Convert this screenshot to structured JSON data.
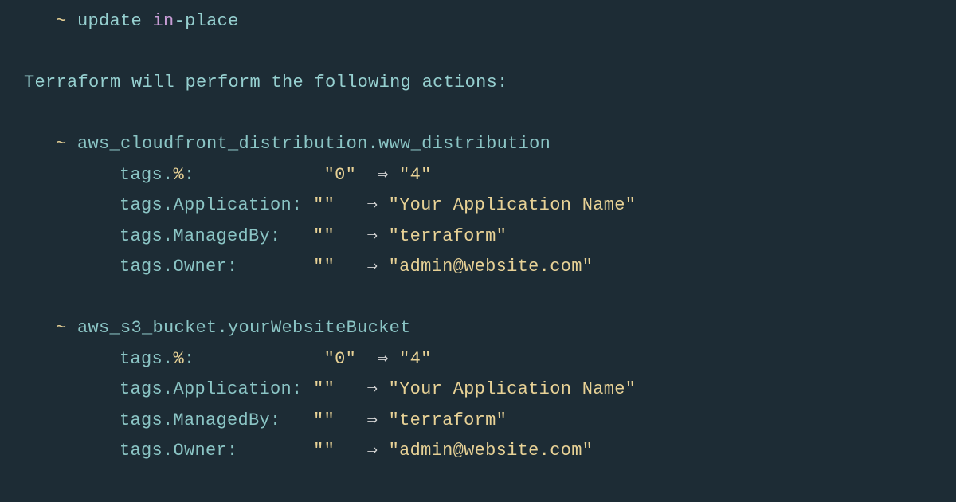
{
  "legend": {
    "tilde": "~",
    "update_text": " update ",
    "keyword_in": "in",
    "place_text": "-place"
  },
  "intro": "Terraform will perform the following actions:",
  "arrow": "⇒",
  "resources": [
    {
      "tilde": "~",
      "address": " aws_cloudfront_distribution.www_distribution",
      "changes": [
        {
          "key": "tags.",
          "symbol": "%",
          "colon": ":            ",
          "old": "\"0\"",
          "gap": "  ",
          "new": "\"4\""
        },
        {
          "key": "tags.Application",
          "symbol": "",
          "colon": ": ",
          "old": "\"\"",
          "gap": "   ",
          "new": "\"Your Application Name\""
        },
        {
          "key": "tags.ManagedBy",
          "symbol": "",
          "colon": ":   ",
          "old": "\"\"",
          "gap": "   ",
          "new": "\"terraform\""
        },
        {
          "key": "tags.Owner",
          "symbol": "",
          "colon": ":       ",
          "old": "\"\"",
          "gap": "   ",
          "new": "\"admin@website.com\""
        }
      ]
    },
    {
      "tilde": "~",
      "address": " aws_s3_bucket.yourWebsiteBucket",
      "changes": [
        {
          "key": "tags.",
          "symbol": "%",
          "colon": ":            ",
          "old": "\"0\"",
          "gap": "  ",
          "new": "\"4\""
        },
        {
          "key": "tags.Application",
          "symbol": "",
          "colon": ": ",
          "old": "\"\"",
          "gap": "   ",
          "new": "\"Your Application Name\""
        },
        {
          "key": "tags.ManagedBy",
          "symbol": "",
          "colon": ":   ",
          "old": "\"\"",
          "gap": "   ",
          "new": "\"terraform\""
        },
        {
          "key": "tags.Owner",
          "symbol": "",
          "colon": ":       ",
          "old": "\"\"",
          "gap": "   ",
          "new": "\"admin@website.com\""
        }
      ]
    }
  ]
}
